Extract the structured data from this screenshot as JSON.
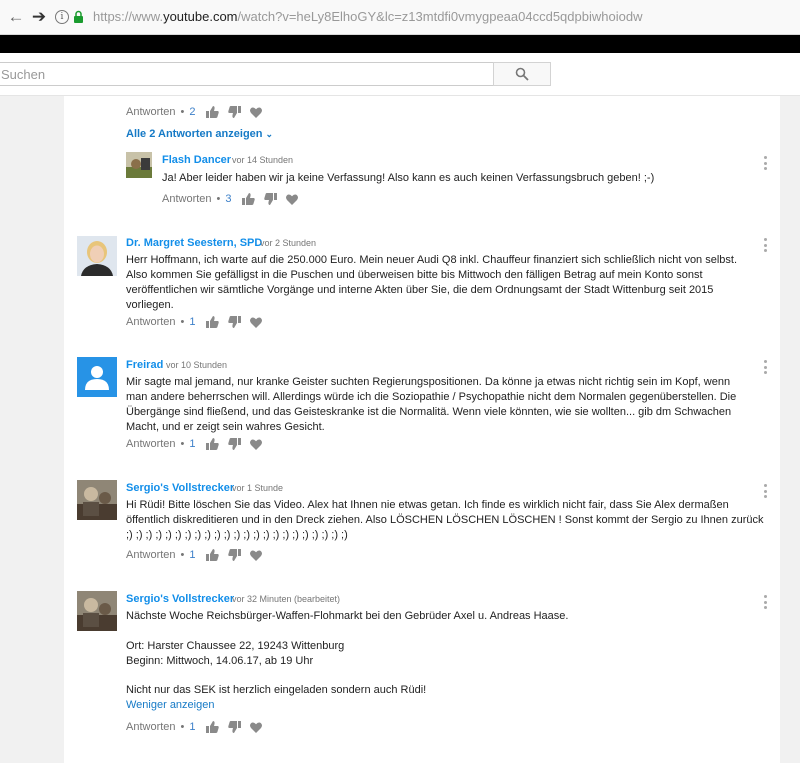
{
  "browser": {
    "back_icon": "arrow-left",
    "forward_icon": "arrow-right",
    "url_prefix": "https://www.",
    "url_domain": "youtube.com",
    "url_rest": "/watch?v=heLy8ElhoGY&lc=z13mtdfi0vmygpeaa04ccd5qdpbiwhoiodw"
  },
  "masthead": {
    "search_placeholder": "Suchen",
    "search_icon": "magnifier"
  },
  "labels": {
    "reply": "Antworten",
    "separator": "•",
    "show_replies": "Alle 2 Antworten anzeigen",
    "show_less": "Weniger anzeigen"
  },
  "top_actions": {
    "likes": "2"
  },
  "comments": [
    {
      "author": "Flash Dancer",
      "time": "vor 14 Stunden",
      "text": "Ja! Aber leider haben wir ja keine Verfassung! Also kann es auch keinen Verfassungsbruch geben! ;-)",
      "likes": "3"
    },
    {
      "author": "Dr. Margret Seestern, SPD",
      "time": "vor 2 Stunden",
      "text": "Herr Hoffmann, ich warte auf die 250.000 Euro. Mein neuer Audi Q8 inkl. Chauffeur finanziert sich schließlich nicht von selbst. Also kommen Sie gefälligst in die Puschen und überweisen bitte bis Mittwoch den fälligen Betrag auf mein Konto sonst veröffentlichen wir sämtliche Vorgänge und interne Akten über Sie, die dem Ordnungsamt der Stadt Wittenburg seit 2015 vorliegen.",
      "likes": "1"
    },
    {
      "author": "Freirad",
      "time": "vor 10 Stunden",
      "text": "Mir sagte mal jemand, nur kranke Geister suchten Regierungspositionen. Da könne ja etwas nicht richtig sein im Kopf, wenn man andere beherrschen will. Allerdings würde ich die Soziopathie / Psychopathie nicht dem Normalen gegenüberstellen. Die Übergänge sind fließend, und das Geisteskranke ist die Normalitä. Wenn viele könnten, wie sie wollten... gib dm Schwachen Macht, und er zeigt sein wahres Gesicht.",
      "likes": "1"
    },
    {
      "author": "Sergio's Vollstrecker",
      "time": "vor 1 Stunde",
      "text": "Hi Rüdi! Bitte löschen Sie das Video. Alex hat Ihnen nie etwas getan. Ich finde es wirklich nicht fair, dass Sie Alex dermaßen öffentlich diskreditieren und in den Dreck ziehen. Also LÖSCHEN LÖSCHEN LÖSCHEN ! Sonst kommt der Sergio zu Ihnen zurück ;) ;) ;) ;) ;) ;) ;) ;) ;) ;) ;) ;) ;) ;) ;) ;) ;) ;) ;) ;) ;) ;) ;)",
      "likes": "1"
    },
    {
      "author": "Sergio's Vollstrecker",
      "time": "vor 32 Minuten (bearbeitet)",
      "line1": "Nächste Woche Reichsbürger-Waffen-Flohmarkt bei den Gebrüder Axel u. Andreas Haase.",
      "line2": "Ort: Harster Chaussee 22, 19243 Wittenburg",
      "line3": "Beginn: Mittwoch, 14.06.17, ab 19 Uhr",
      "line4": "Nicht nur das SEK ist herzlich eingeladen sondern auch Rüdi!",
      "likes": "1"
    }
  ],
  "colors": {
    "link_blue": "#167ac6",
    "author_blue": "#128ee9",
    "like_count_blue": "#3d80c9",
    "meta_gray": "#767676",
    "icon_gray": "#8a8a8a",
    "default_avatar_bg": "#2793e6"
  }
}
